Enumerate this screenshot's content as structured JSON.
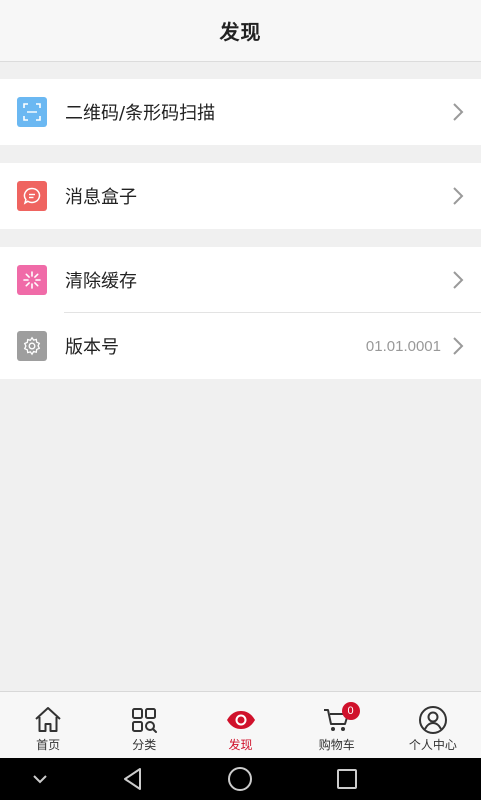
{
  "header": {
    "title": "发现"
  },
  "menu": {
    "scan": {
      "label": "二维码/条形码扫描",
      "icon": "scan-icon",
      "color": "#6bb8f2"
    },
    "messages": {
      "label": "消息盒子",
      "icon": "message-icon",
      "color": "#ef6460"
    },
    "cache": {
      "label": "清除缓存",
      "icon": "clear-cache-icon",
      "color": "#f06ba8"
    },
    "version": {
      "label": "版本号",
      "value": "01.01.0001",
      "icon": "gear-icon",
      "color": "#9e9e9e"
    }
  },
  "tabs": [
    {
      "label": "首页",
      "icon": "home-icon"
    },
    {
      "label": "分类",
      "icon": "category-icon"
    },
    {
      "label": "发现",
      "icon": "eye-icon",
      "active": true
    },
    {
      "label": "购物车",
      "icon": "cart-icon",
      "badge": "0"
    },
    {
      "label": "个人中心",
      "icon": "user-icon"
    }
  ],
  "colors": {
    "accent": "#d0112b",
    "background": "#f0f0f0"
  }
}
